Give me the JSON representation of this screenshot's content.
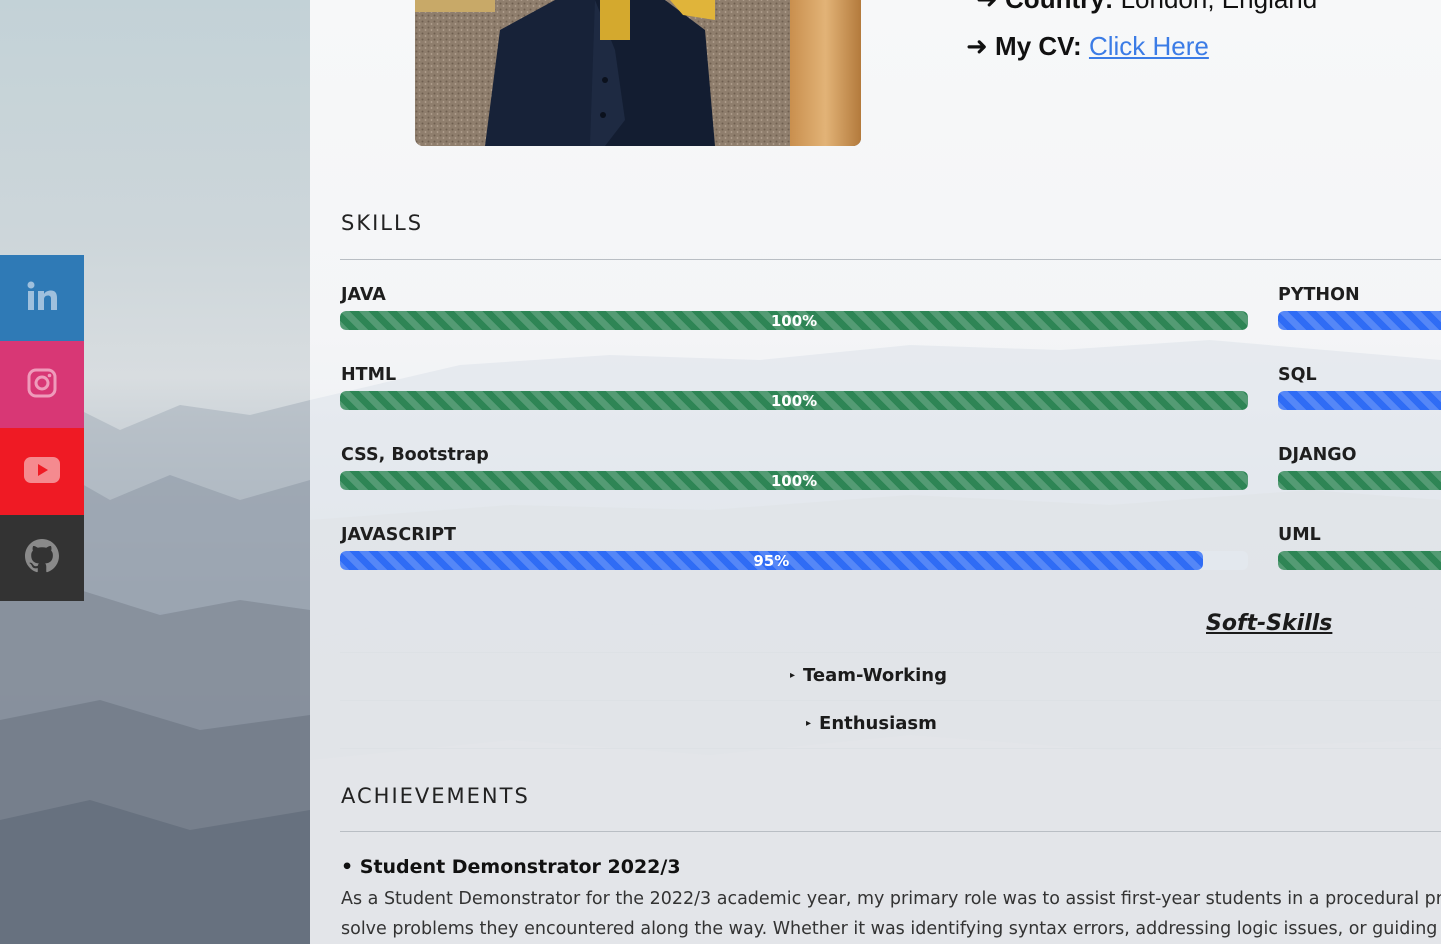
{
  "social": {
    "items": [
      {
        "name": "linkedin",
        "icon": "linkedin-icon",
        "color": "#2f7ab6"
      },
      {
        "name": "instagram",
        "icon": "instagram-icon",
        "color": "#d83775"
      },
      {
        "name": "youtube",
        "icon": "youtube-icon",
        "color": "#ef1a24"
      },
      {
        "name": "github",
        "icon": "github-icon",
        "color": "#333333"
      }
    ]
  },
  "profile": {
    "country_label": "Country:",
    "country_value": "London, England",
    "cv_label": "My CV:",
    "cv_link": "Click Here",
    "arrow": "➜"
  },
  "skills": {
    "heading": "SKILLS",
    "left": [
      {
        "label": "JAVA",
        "percent": 100,
        "text": "100%",
        "color": "green"
      },
      {
        "label": "HTML",
        "percent": 100,
        "text": "100%",
        "color": "green"
      },
      {
        "label": "CSS, Bootstrap",
        "percent": 100,
        "text": "100%",
        "color": "green"
      },
      {
        "label": "JAVASCRIPT",
        "percent": 95,
        "text": "95%",
        "color": "blue"
      }
    ],
    "right": [
      {
        "label": "PYTHON",
        "color": "blue"
      },
      {
        "label": "SQL",
        "color": "blue"
      },
      {
        "label": "DJANGO",
        "color": "green"
      },
      {
        "label": "UML",
        "color": "green"
      }
    ]
  },
  "soft_skills": {
    "heading": "Soft-Skills",
    "items": [
      "Team-Working",
      "Enthusiasm"
    ],
    "marker": "▸"
  },
  "achievements": {
    "heading": "ACHIEVEMENTS",
    "title": "• Student Demonstrator 2022/3",
    "line1": "As a Student Demonstrator for the 2022/3 academic year, my primary role was to assist first-year students in a procedural pro",
    "line2": "solve problems they encountered along the way. Whether it was identifying syntax errors, addressing logic issues, or guiding"
  },
  "colors": {
    "green": "#2e8555",
    "blue": "#2f6cf5",
    "link": "#3b7ce6"
  }
}
